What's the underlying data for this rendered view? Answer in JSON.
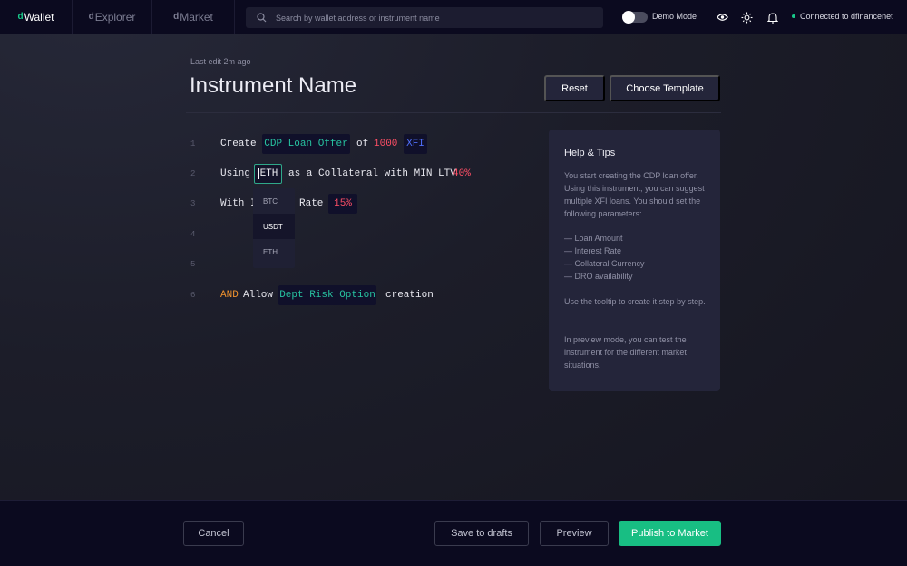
{
  "nav": {
    "tabs": [
      {
        "prefix": "d",
        "label": "Wallet"
      },
      {
        "prefix": "d",
        "label": "Explorer"
      },
      {
        "prefix": "d",
        "label": "Market"
      }
    ],
    "search_placeholder": "Search by wallet address or instrument name",
    "demo_mode_label": "Demo Mode",
    "demo_mode_on": false,
    "connection_label": "Connected to dfinancenet"
  },
  "editor": {
    "last_edit": "Last edit 2m ago",
    "title": "Instrument Name",
    "reset_label": "Reset",
    "template_label": "Choose Template",
    "line_numbers": [
      "1",
      "2",
      "3",
      "4",
      "5",
      "6"
    ],
    "line1": {
      "w1": "Create",
      "chip1": "CDP Loan Offer",
      "w2": "of",
      "amount": "1000",
      "currency": "XFI"
    },
    "line2": {
      "w1": "Using",
      "chip": "ETH",
      "w2": "as a Collateral with MIN LTV",
      "ltv": "40%"
    },
    "line3": {
      "w1": "With I",
      "w2": "Rate",
      "rate": "15%"
    },
    "line6": {
      "w1": "AND",
      "w2": "Allow",
      "chip": "Dept Risk Option",
      "w3": "creation"
    },
    "dropdown_options": [
      "BTC",
      "USDT",
      "ETH"
    ],
    "dropdown_selected": "USDT"
  },
  "help": {
    "title": "Help & Tips",
    "p1": "You start creating the CDP loan offer. Using this instrument, you can suggest multiple XFI loans. You should set the following parameters:",
    "params": [
      "— Loan Amount",
      "— Interest Rate",
      "— Collateral Currency",
      "— DRO availability"
    ],
    "p2": "Use the tooltip to create it step by step.",
    "p3": "In preview mode, you can test the instrument for the different market situations."
  },
  "footer": {
    "cancel_label": "Cancel",
    "drafts_label": "Save to drafts",
    "preview_label": "Preview",
    "publish_label": "Publish to Market"
  },
  "colors": {
    "accent_green": "#18be83",
    "keyword_teal": "#27c2a0",
    "value_red": "#ff4f66",
    "currency_blue": "#4f6ef7",
    "operator_orange": "#f0922e"
  }
}
